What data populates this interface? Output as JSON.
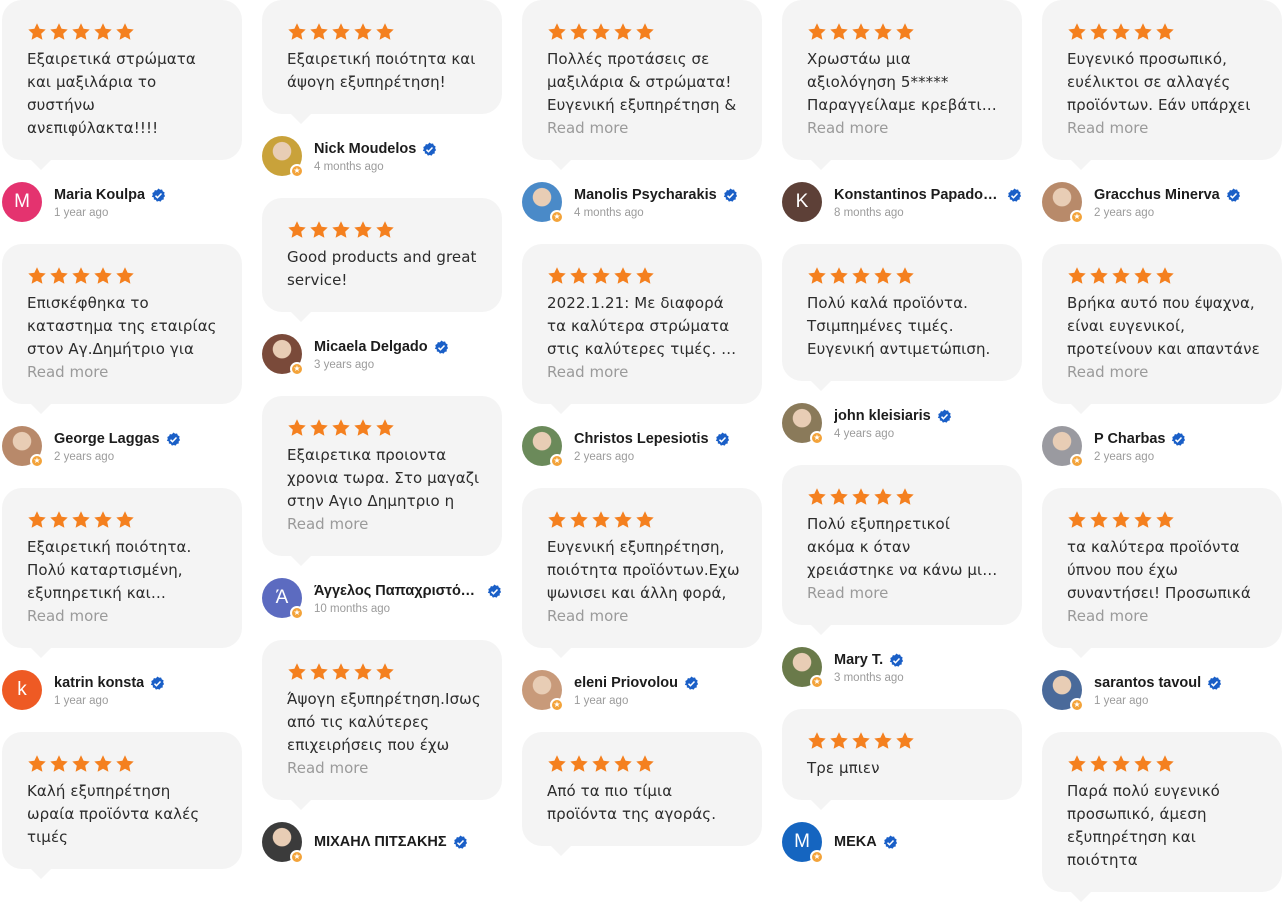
{
  "colors": {
    "star": "#f4801f",
    "bubble": "#f4f4f4",
    "verified": "#1a5fc7",
    "readmore": "#9a9a9a"
  },
  "ui": {
    "read_more": "Read more"
  },
  "columns": [
    [
      {
        "rating": 5,
        "text": "Εξαιρετικά στρώματα και μαξιλάρια το συστήνω ανεπιφύλακτα!!!!",
        "read_more": false,
        "author": "Maria Koulpa",
        "time": "1 year ago",
        "avatar": {
          "type": "letter",
          "letter": "M",
          "color": "#e4336f"
        }
      },
      {
        "rating": 5,
        "text": "Επισκέφθηκα το καταστημα της εταιρίας στον Αγ.Δημήτριο για",
        "read_more": true,
        "author": "George Laggas",
        "time": "2 years ago",
        "avatar": {
          "type": "photo",
          "color": "#b8896a"
        }
      },
      {
        "rating": 5,
        "text": "Εξαιρετική ποιότητα. Πολύ καταρτισμένη, εξυπηρετική και ευγενική",
        "read_more": true,
        "author": "katrin konsta",
        "time": "1 year ago",
        "avatar": {
          "type": "letter",
          "letter": "k",
          "color": "#ee5a24"
        }
      },
      {
        "rating": 5,
        "text": "Καλή εξυπηρέτηση ωραία προϊόντα καλές τιμές",
        "read_more": false,
        "author": "",
        "time": "",
        "avatar": null
      }
    ],
    [
      {
        "rating": 5,
        "text": "Εξαιρετική ποιότητα και άψογη εξυπηρέτηση!",
        "read_more": false,
        "author": "Nick Moudelos",
        "time": "4 months ago",
        "avatar": {
          "type": "photo",
          "color": "#c9a23a"
        }
      },
      {
        "rating": 5,
        "text": "Good products and great service!",
        "read_more": false,
        "author": "Micaela Delgado",
        "time": "3 years ago",
        "avatar": {
          "type": "photo",
          "color": "#7a4a3a"
        }
      },
      {
        "rating": 5,
        "text": "Εξαιρετικα προιοντα χρονια τωρα. Στο μαγαζι στην Αγιο Δημητριο η",
        "read_more": true,
        "author": "Άγγελος Παπαχριστόπουλος",
        "time": "10 months ago",
        "avatar": {
          "type": "letter",
          "letter": "Ά",
          "color": "#5c6bc0"
        }
      },
      {
        "rating": 5,
        "text": "Άψογη εξυπηρέτηση.Ισως από τις καλύτερες επιχειρήσεις που έχω",
        "read_more": true,
        "author": "ΜΙΧΑΗΛ ΠΙΤΣΑΚΗΣ",
        "time": "",
        "avatar": {
          "type": "photo",
          "color": "#3b3b3b"
        }
      }
    ],
    [
      {
        "rating": 5,
        "text": "Πολλές προτάσεις σε μαξιλάρια & στρώματα! Ευγενική εξυπηρέτηση &",
        "read_more": true,
        "author": "Manolis Psycharakis",
        "time": "4 months ago",
        "avatar": {
          "type": "photo",
          "color": "#4a8ac8"
        }
      },
      {
        "rating": 5,
        "text": "2022.1.21: Με διαφορά τα καλύτερα στρώματα στις καλύτερες τιμές. Η εταιρία",
        "read_more": true,
        "author": "Christos Lepesiotis",
        "time": "2 years ago",
        "avatar": {
          "type": "photo",
          "color": "#6b8a5a"
        }
      },
      {
        "rating": 5,
        "text": "Ευγενική εξυπηρέτηση, ποιότητα προϊόντων.Εχω ψωνισει και άλλη φορά,",
        "read_more": true,
        "author": "eleni Priovolou",
        "time": "1 year ago",
        "avatar": {
          "type": "photo",
          "color": "#c89a7a"
        }
      },
      {
        "rating": 5,
        "text": "Από τα πιο τίμια προϊόντα της αγοράς.",
        "read_more": false,
        "author": "",
        "time": "",
        "avatar": null
      }
    ],
    [
      {
        "rating": 5,
        "text": "Χρωστάω μια αξιολόγηση 5***** Παραγγείλαμε κρεβάτι και στρώμα.",
        "read_more": true,
        "author": "Konstantinos Papadopoulos",
        "time": "8 months ago",
        "avatar": {
          "type": "letter",
          "letter": "K",
          "color": "#5d4037"
        }
      },
      {
        "rating": 5,
        "text": "Πολύ καλά προϊόντα. Τσιμπημένες τιμές. Ευγενική αντιμετώπιση.",
        "read_more": false,
        "author": "john kleisiaris",
        "time": "4 years ago",
        "avatar": {
          "type": "photo",
          "color": "#8a7a5a"
        }
      },
      {
        "rating": 5,
        "text": "Πολύ εξυπηρετικοί ακόμα κ όταν χρειάστηκε να κάνω μια αλλαγή που δεν",
        "read_more": true,
        "author": "Mary T.",
        "time": "3 months ago",
        "avatar": {
          "type": "photo",
          "color": "#6a7a4a"
        }
      },
      {
        "rating": 5,
        "text": "Τρε μπιεν",
        "read_more": false,
        "author": "ΜΕΚΑ",
        "time": "",
        "avatar": {
          "type": "letter",
          "letter": "M",
          "color": "#1565c0"
        }
      }
    ],
    [
      {
        "rating": 5,
        "text": "Ευγενικό προσωπικό, ευέλικτοι σε αλλαγές προϊόντων. Εάν υπάρχει",
        "read_more": true,
        "author": "Gracchus Minerva",
        "time": "2 years ago",
        "avatar": {
          "type": "photo",
          "color": "#b88a6a"
        }
      },
      {
        "rating": 5,
        "text": "Βρήκα αυτό που έψαχνα, είναι ευγενικοί, προτείνουν και απαντάνε",
        "read_more": true,
        "author": "P Charbas",
        "time": "2 years ago",
        "avatar": {
          "type": "photo",
          "color": "#9a9aa0"
        }
      },
      {
        "rating": 5,
        "text": "τα καλύτερα προϊόντα ύπνου που έχω συναντήσει! Προσωπικά",
        "read_more": true,
        "author": "sarantos tavoul",
        "time": "1 year ago",
        "avatar": {
          "type": "photo",
          "color": "#4a6a9a"
        }
      },
      {
        "rating": 5,
        "text": "Παρά πολύ ευγενικό προσωπικό, άμεση εξυπηρέτηση και ποιότητα",
        "read_more": false,
        "author": "",
        "time": "",
        "avatar": null
      }
    ]
  ]
}
